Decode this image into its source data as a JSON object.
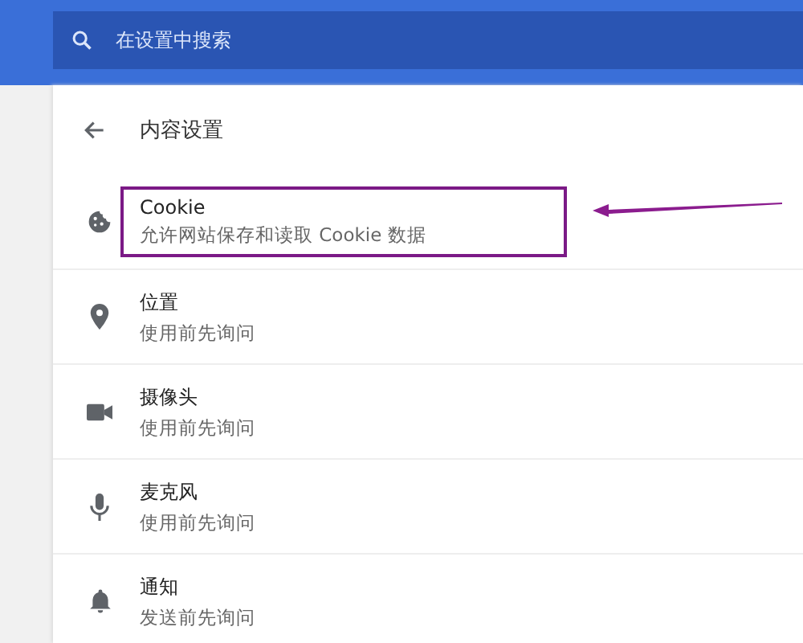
{
  "search": {
    "placeholder": "在设置中搜索"
  },
  "page": {
    "title": "内容设置"
  },
  "items": [
    {
      "kind": "cookie",
      "title": "Cookie",
      "subtitle": "允许网站保存和读取 Cookie 数据",
      "highlighted": true
    },
    {
      "kind": "location",
      "title": "位置",
      "subtitle": "使用前先询问",
      "highlighted": false
    },
    {
      "kind": "camera",
      "title": "摄像头",
      "subtitle": "使用前先询问",
      "highlighted": false
    },
    {
      "kind": "microphone",
      "title": "麦克风",
      "subtitle": "使用前先询问",
      "highlighted": false
    },
    {
      "kind": "notification",
      "title": "通知",
      "subtitle": "发送前先询问",
      "highlighted": false
    }
  ]
}
